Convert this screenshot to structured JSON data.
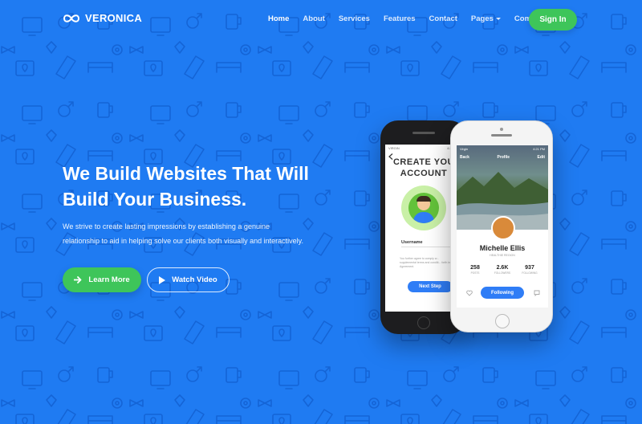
{
  "colors": {
    "background": "#1f7bf2",
    "accent_green": "#3ec55a",
    "phone_button_blue": "#2f7df6"
  },
  "brand": {
    "name": "VERONICA"
  },
  "nav": {
    "items": [
      {
        "label": "Home",
        "active": true
      },
      {
        "label": "About"
      },
      {
        "label": "Services"
      },
      {
        "label": "Features"
      },
      {
        "label": "Contact"
      },
      {
        "label": "Pages",
        "dropdown": true
      },
      {
        "label": "Component",
        "dropdown": true
      }
    ],
    "signin_label": "Sign In"
  },
  "hero": {
    "title_line1": "We Build Websites That Will",
    "title_line2": "Build Your Business.",
    "subtitle_line1": "We strive to create lasting impressions by establishing a genuine",
    "subtitle_line2": "relationship to aid in helping solve our clients both visually and interactively.",
    "learn_more_label": "Learn More",
    "watch_video_label": "Watch Video"
  },
  "phone_left": {
    "status_left": "VIRGIN",
    "status_right": "4:21 PM",
    "title_line1": "CREATE YOU",
    "title_line2": "ACCOUNT",
    "field_label": "Username",
    "fine_print": "You further agree to comply w... supplemental terms and conditi... forth in this Agreement.",
    "next_label": "Next Step"
  },
  "phone_right": {
    "status_left": "Virgin",
    "status_right": "4:21 PM",
    "back_label": "Back",
    "header_title": "Profile",
    "edit_label": "Edit",
    "name": "Michelle Ellis",
    "location": "HEALTHIE REGION",
    "stats": [
      {
        "value": "258",
        "label": "POSTS"
      },
      {
        "value": "2.6K",
        "label": "FOLLOWERS"
      },
      {
        "value": "937",
        "label": "FOLLOWING"
      }
    ],
    "following_label": "Following"
  }
}
